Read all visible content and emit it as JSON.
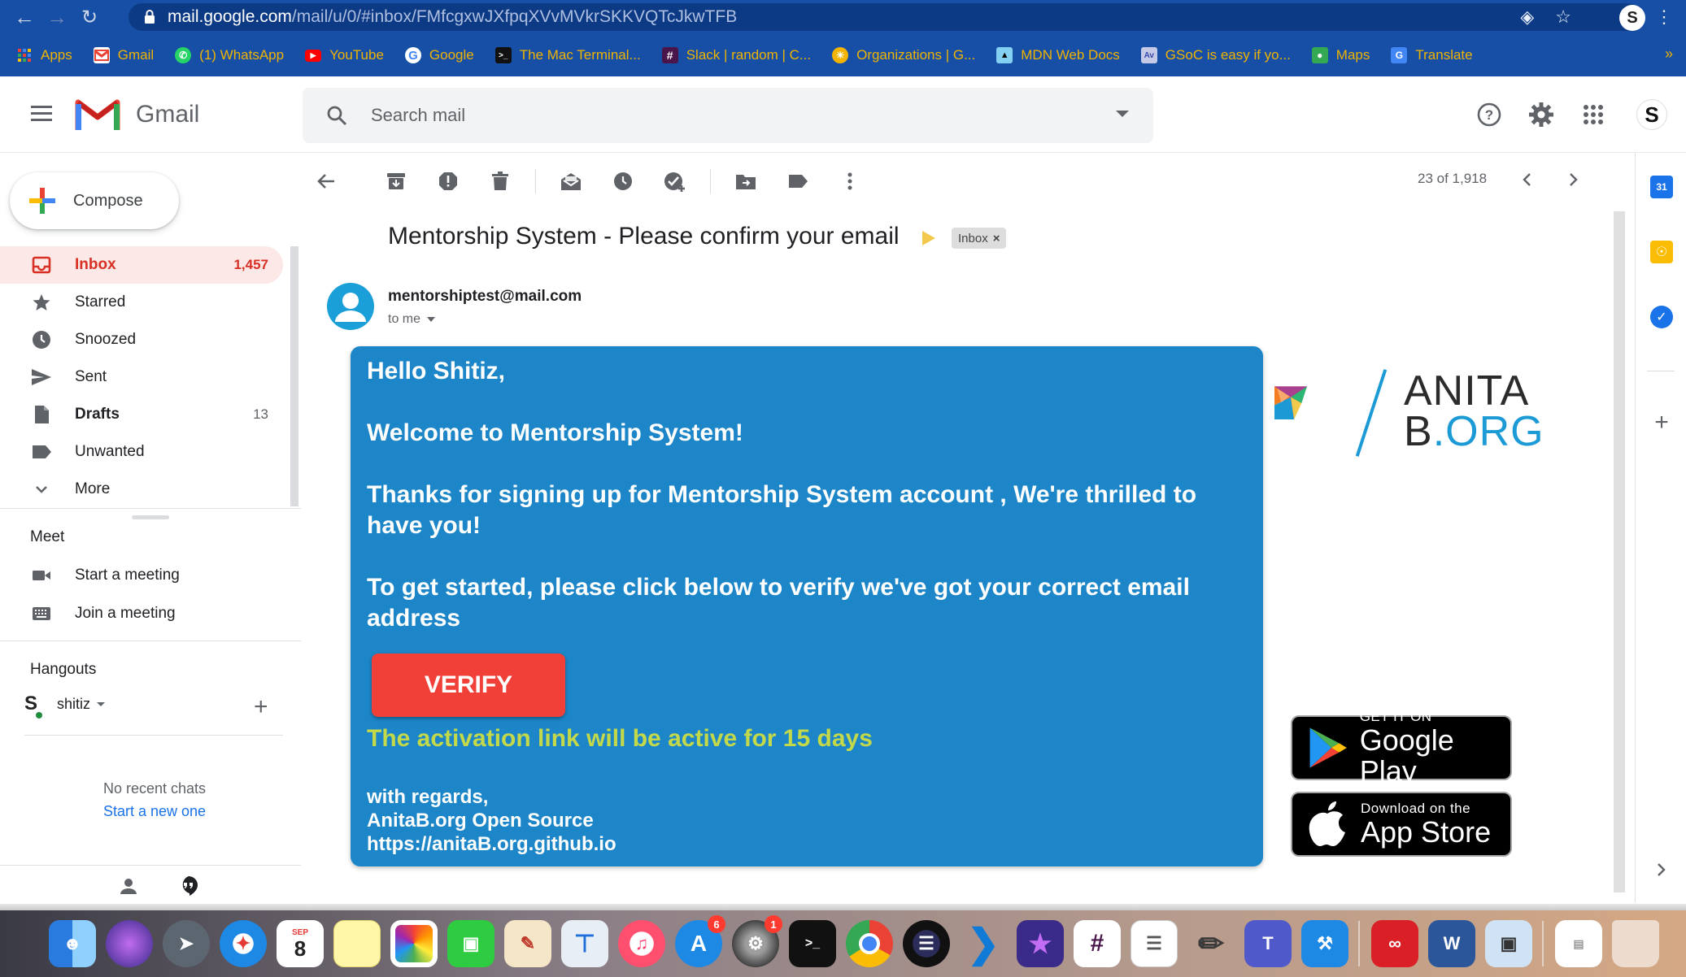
{
  "browser": {
    "url_host": "mail.google.com",
    "url_path": "/mail/u/0/#inbox/FMfcgxwJXfpqXVvMVkrSKKVQTcJkwTFB",
    "profile_initial": "S"
  },
  "bookmarks": [
    {
      "label": "Apps",
      "icon": "apps-grid-icon",
      "color": "#4285f4"
    },
    {
      "label": "Gmail",
      "icon": "gmail-icon",
      "color": "#ea4335"
    },
    {
      "label": "(1) WhatsApp",
      "icon": "whatsapp-icon",
      "color": "#25d366"
    },
    {
      "label": "YouTube",
      "icon": "youtube-icon",
      "color": "#ff0000"
    },
    {
      "label": "Google",
      "icon": "google-icon",
      "color": "#ffffff"
    },
    {
      "label": "The Mac Terminal...",
      "icon": "terminal-icon",
      "color": "#111111"
    },
    {
      "label": "Slack | random | C...",
      "icon": "slack-icon",
      "color": "#4a154b"
    },
    {
      "label": "Organizations | G...",
      "icon": "sun-icon",
      "color": "#f4b400"
    },
    {
      "label": "MDN Web Docs",
      "icon": "mdn-icon",
      "color": "#83d0f2"
    },
    {
      "label": "GSoC is easy if yo...",
      "icon": "article-icon",
      "color": "#5c6bc0"
    },
    {
      "label": "Maps",
      "icon": "maps-icon",
      "color": "#34a853"
    },
    {
      "label": "Translate",
      "icon": "translate-icon",
      "color": "#4285f4"
    }
  ],
  "header": {
    "product": "Gmail",
    "search_placeholder": "Search mail"
  },
  "sidebar": {
    "compose_label": "Compose",
    "items": [
      {
        "label": "Inbox",
        "count": "1,457",
        "icon": "inbox-icon"
      },
      {
        "label": "Starred",
        "count": "",
        "icon": "star-icon"
      },
      {
        "label": "Snoozed",
        "count": "",
        "icon": "clock-icon"
      },
      {
        "label": "Sent",
        "count": "",
        "icon": "send-icon"
      },
      {
        "label": "Drafts",
        "count": "13",
        "icon": "draft-icon"
      },
      {
        "label": "Unwanted",
        "count": "",
        "icon": "label-icon"
      },
      {
        "label": "More",
        "count": "",
        "icon": "chevron-down-icon"
      }
    ]
  },
  "meet": {
    "title": "Meet",
    "start": "Start a meeting",
    "join": "Join a meeting"
  },
  "hangouts": {
    "title": "Hangouts",
    "user": "shitiz",
    "no_chats": "No recent chats",
    "start_new": "Start a new one"
  },
  "toolbar": {
    "pager": "23 of 1,918"
  },
  "message": {
    "subject": "Mentorship System - Please confirm your email",
    "label": "Inbox",
    "sender": "mentorshiptest@mail.com",
    "to": "to me",
    "greeting": "Hello Shitiz,",
    "welcome": "Welcome to Mentorship System!",
    "thanks": "Thanks for signing up for Mentorship System account , We're thrilled to have you!",
    "instructions": "To get started, please click  below to verify we've got your correct email address",
    "verify_label": "VERIFY",
    "activation": "The activation link will be active for 15 days",
    "regards_1": "with regards,",
    "regards_2": "AnitaB.org Open Source",
    "regards_3": "https://anitaB.org.github.io"
  },
  "branding": {
    "word_1": "ANITA",
    "word_2_a": "B",
    "word_2_b": ".ORG"
  },
  "badges": {
    "google_small": "GET IT ON",
    "google_big": "Google Play",
    "apple_small": "Download on the",
    "apple_big": "App Store"
  },
  "side_panel": {
    "calendar_day": "31"
  },
  "dock": {
    "calendar_month": "SEP",
    "calendar_day": "8",
    "appstore_badge": "6",
    "prefs_badge": "1"
  },
  "colors": {
    "browser_chrome": "#174ea6",
    "bookmark_text": "#f0b400",
    "inbox_active": "#d93025",
    "mail_card": "#1c86c8",
    "verify_button": "#f04038",
    "activation_text": "#c4d94a",
    "anita_blue": "#1c9ad6"
  }
}
